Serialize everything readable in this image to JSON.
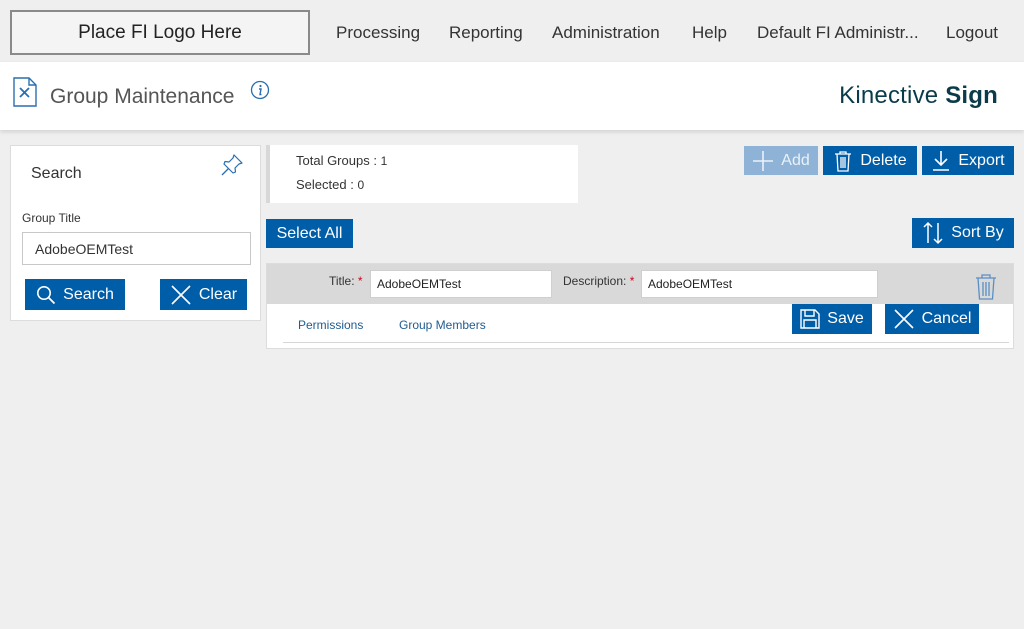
{
  "nav": {
    "logo_text": "Place FI Logo Here",
    "items": [
      "Processing",
      "Reporting",
      "Administration",
      "Help",
      "Default FI Administr...",
      "Logout"
    ]
  },
  "header": {
    "title": "Group Maintenance",
    "brand_light": "Kinective",
    "brand_bold": "Sign"
  },
  "search": {
    "title": "Search",
    "field_label": "Group Title",
    "field_value": "AdobeOEMTest",
    "search_label": "Search",
    "clear_label": "Clear"
  },
  "summary": {
    "total_label": "Total Groups :",
    "total_value": "1",
    "selected_label": "Selected :",
    "selected_value": "0"
  },
  "toolbar": {
    "add_label": "Add",
    "delete_label": "Delete",
    "export_label": "Export",
    "select_all_label": "Select All",
    "sort_label": "Sort By"
  },
  "group": {
    "title_label": "Title:",
    "title_value": "AdobeOEMTest",
    "description_label": "Description:",
    "description_value": "AdobeOEMTest",
    "required_mark": "*",
    "tabs": [
      "Permissions",
      "Group Members"
    ],
    "save_label": "Save",
    "cancel_label": "Cancel"
  },
  "colors": {
    "primary": "#005da8",
    "disabled": "#8fb3d6",
    "brand": "#0a3b4a",
    "required": "#d0021b",
    "icon": "#2a6fb0"
  }
}
